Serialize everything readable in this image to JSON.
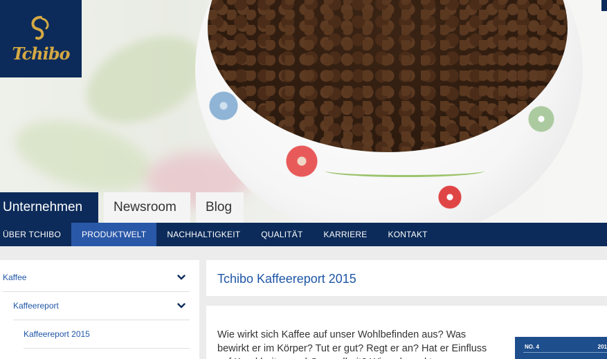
{
  "brand": {
    "logo_text": "Tchibo",
    "color": "#0c2b5a",
    "gold": "#d4a843"
  },
  "tabs": [
    {
      "label": "Unternehmen",
      "active": true
    },
    {
      "label": "Newsroom",
      "active": false
    },
    {
      "label": "Blog",
      "active": false
    }
  ],
  "nav": {
    "items": [
      {
        "label": "ÜBER TCHIBO",
        "active": false
      },
      {
        "label": "PRODUKTWELT",
        "active": true
      },
      {
        "label": "NACHHALTIGKEIT",
        "active": false
      },
      {
        "label": "QUALITÄT",
        "active": false
      },
      {
        "label": "KARRIERE",
        "active": false
      },
      {
        "label": "KONTAKT",
        "active": false
      }
    ],
    "active_color": "#2a58a8"
  },
  "sidebar": {
    "items": [
      {
        "label": "Kaffee",
        "icon": "chevron-down-icon"
      },
      {
        "label": "Kaffeereport",
        "icon": "chevron-down-icon"
      },
      {
        "label": "Kaffeereport 2015"
      }
    ]
  },
  "main": {
    "title": "Tchibo Kaffeereport 2015",
    "body": "Wie wirkt sich Kaffee auf unser Wohlbefinden aus? Was bewirkt er im Körper? Tut er gut? Regt er an? Hat er Einfluss auf Krankheiten und Gesundheit? Wie schmeckt",
    "thumbnail": {
      "left_text": "NO. 4",
      "right_text": "201"
    }
  }
}
